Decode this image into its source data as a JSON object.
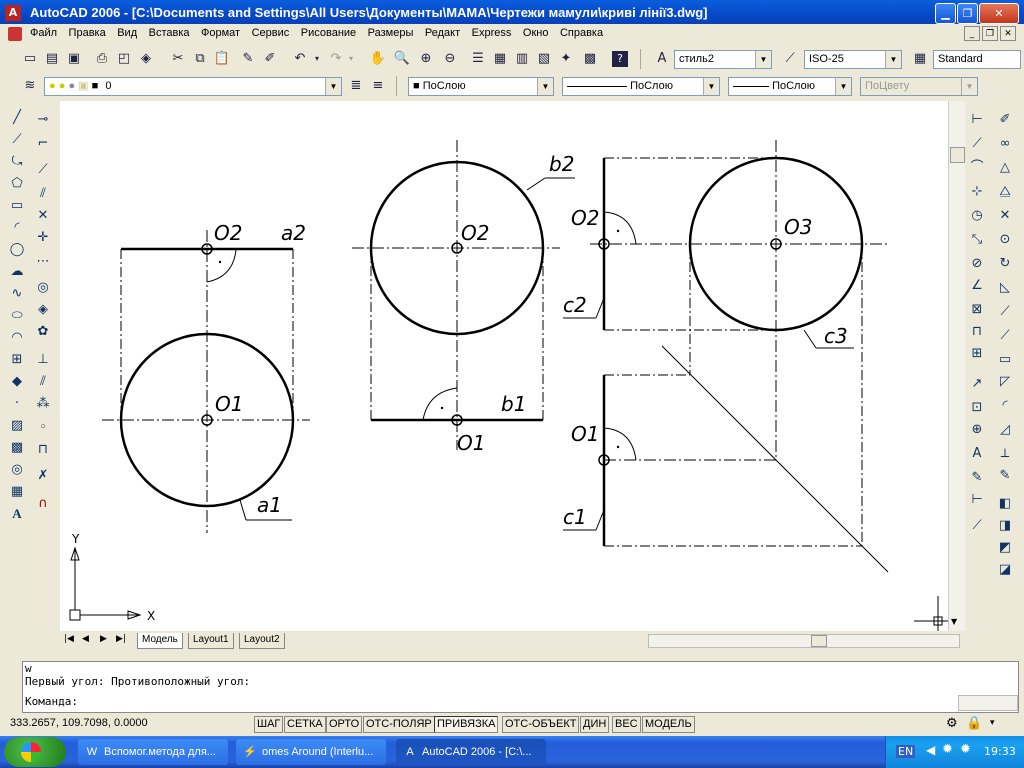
{
  "window": {
    "title": "AutoCAD 2006 - [C:\\Documents and Settings\\All Users\\Документы\\МАМА\\Чертежи мамули\\криві лінії3.dwg]",
    "app_icon": "autocad-icon",
    "buttons": [
      "minimize",
      "restore",
      "close"
    ]
  },
  "menu": {
    "items": [
      "Файл",
      "Правка",
      "Вид",
      "Вставка",
      "Формат",
      "Сервис",
      "Рисование",
      "Размеры",
      "Редакт",
      "Express",
      "Окно",
      "Справка"
    ]
  },
  "standard_toolbar": {
    "text_style": "стиль2",
    "dim_style": "ISO-25",
    "table_style": "Standard"
  },
  "layers_toolbar": {
    "layer_name": "0",
    "color": "ПоСлою",
    "linetype": "ПоСлою",
    "lineweight": "ПоСлою",
    "plotstyle": "ПоЦвету"
  },
  "drawing": {
    "labels": {
      "O2_left": "O2",
      "a2": "a2",
      "O1_left": "O1",
      "a1": "a1",
      "b2": "b2",
      "O2_mid": "O2",
      "b1": "b1",
      "O1_mid": "O1",
      "O2_right": "O2",
      "c2": "c2",
      "O3": "O3",
      "c3": "c3",
      "O1_right": "O1",
      "c1": "c1"
    },
    "ucs": {
      "x": "X",
      "y": "Y"
    }
  },
  "layout_tabs": [
    "Модель",
    "Layout1",
    "Layout2"
  ],
  "command_line": {
    "lines": [
      "w",
      "Первый угол: Противоположный угол:",
      "Команда:"
    ]
  },
  "status_bar": {
    "coordinates": "333.2657, 109.7098, 0.0000",
    "toggles": [
      {
        "label": "ШАГ",
        "on": false
      },
      {
        "label": "СЕТКА",
        "on": false
      },
      {
        "label": "ОРТО",
        "on": false
      },
      {
        "label": "ОТС-ПОЛЯР",
        "on": false
      },
      {
        "label": "ПРИВЯЗКА",
        "on": true
      },
      {
        "label": "ОТС-ОБЪЕКТ",
        "on": false
      },
      {
        "label": "ДИН",
        "on": false
      },
      {
        "label": "ВЕС",
        "on": false
      },
      {
        "label": "МОДЕЛЬ",
        "on": false
      }
    ]
  },
  "taskbar": {
    "tasks": [
      {
        "label": "Вспомог.метода для...",
        "icon": "word-icon"
      },
      {
        "label": "omes Around (Interlu...",
        "icon": "winamp-icon"
      },
      {
        "label": "AutoCAD 2006 - [C:\\...",
        "icon": "autocad-icon"
      }
    ],
    "language": "EN",
    "clock": "19:33"
  }
}
